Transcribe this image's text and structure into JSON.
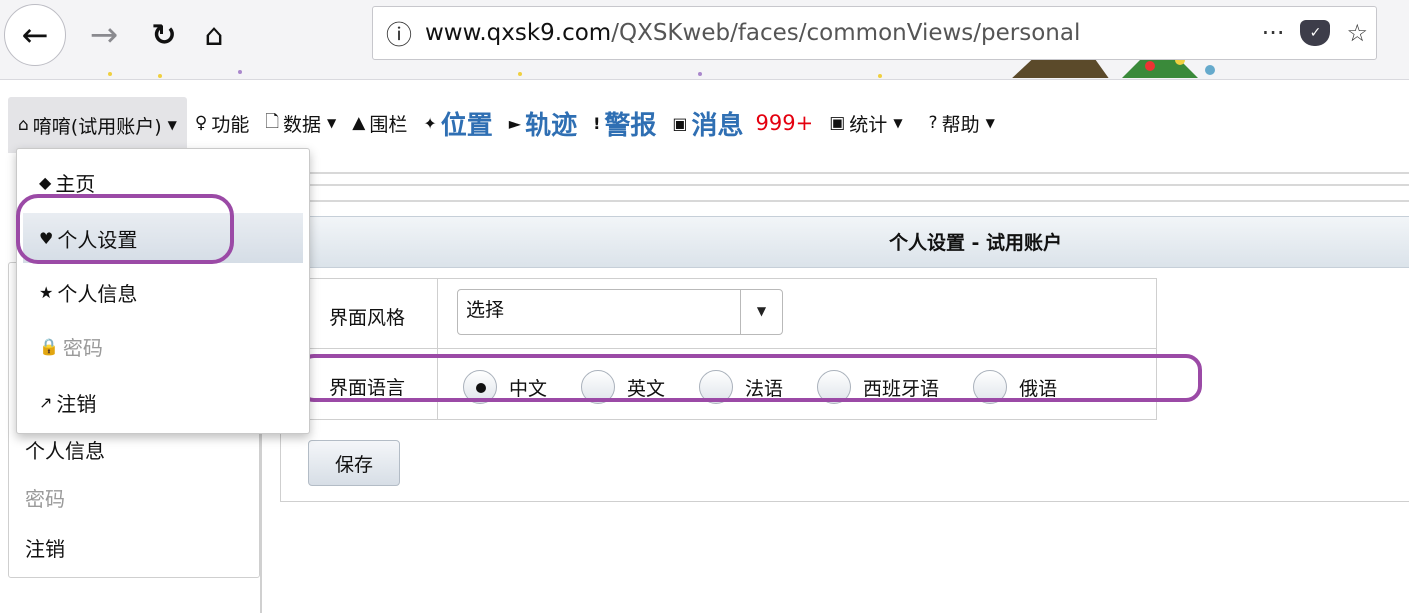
{
  "browser": {
    "url_host": "www.qxsk9.com",
    "url_path": "/QXSKweb/faces/commonViews/personal",
    "overflow_label": "···"
  },
  "menubar": {
    "user_label": "唷唷(试用账户)",
    "items": [
      {
        "label": "功能",
        "icon": "lightbulb-icon"
      },
      {
        "label": "数据",
        "icon": "document-icon"
      },
      {
        "label": "围栏",
        "icon": "warning-triangle-icon"
      },
      {
        "label": "位置",
        "icon": "pin-icon"
      },
      {
        "label": "轨迹",
        "icon": "play-icon"
      },
      {
        "label": "警报",
        "icon": "exclamation-icon"
      },
      {
        "label": "消息",
        "icon": "comment-icon"
      },
      {
        "label": "统计",
        "icon": "picture-icon"
      },
      {
        "label": "帮助",
        "icon": "question-icon"
      }
    ],
    "message_badge": "999+"
  },
  "dropdown": {
    "items": [
      {
        "label": "主页",
        "icon": "tag-icon"
      },
      {
        "label": "个人设置",
        "icon": "heart-icon"
      },
      {
        "label": "个人信息",
        "icon": "star-icon"
      },
      {
        "label": "密码",
        "icon": "lock-icon"
      },
      {
        "label": "注销",
        "icon": "external-link-icon"
      }
    ]
  },
  "sidebar": {
    "items": [
      {
        "label": "个人信息"
      },
      {
        "label": "密码"
      },
      {
        "label": "注销"
      }
    ]
  },
  "panel": {
    "title": "个人设置 - 试用账户"
  },
  "form": {
    "style_label": "界面风格",
    "style_value": "选择",
    "language_label": "界面语言",
    "languages": [
      {
        "label": "中文",
        "checked": true
      },
      {
        "label": "英文",
        "checked": false
      },
      {
        "label": "法语",
        "checked": false
      },
      {
        "label": "西班牙语",
        "checked": false
      },
      {
        "label": "俄语",
        "checked": false
      }
    ],
    "save_label": "保存"
  },
  "colors": {
    "accent_blue": "#2f6fb3",
    "badge_red": "#e4000f",
    "annotation_purple": "#9b4aa6"
  }
}
